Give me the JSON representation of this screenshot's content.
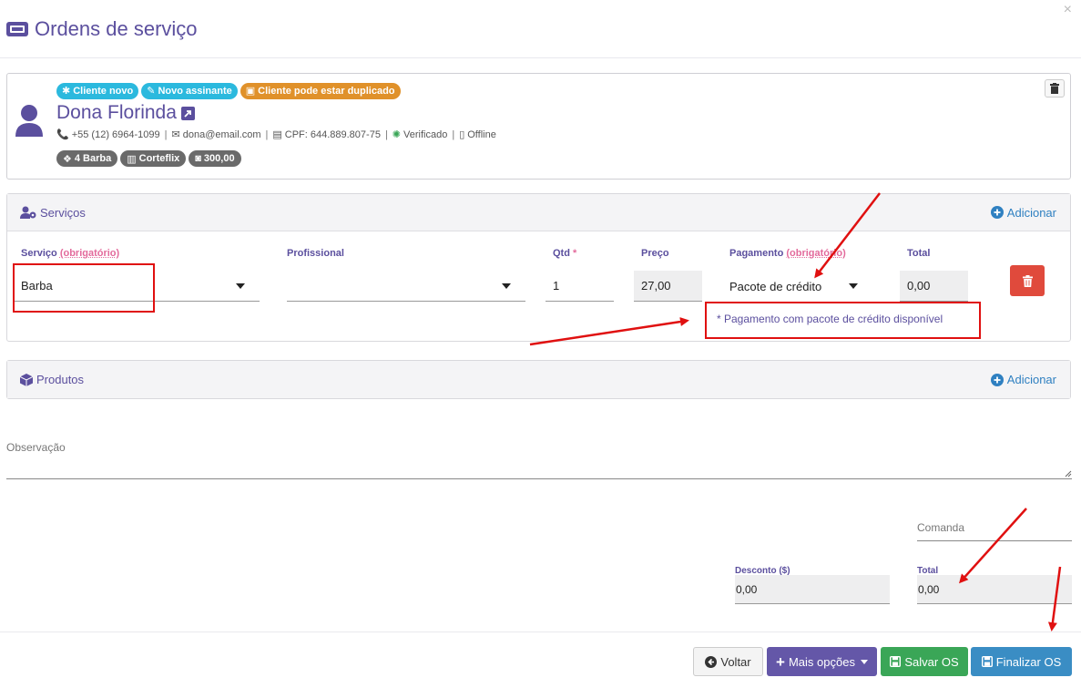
{
  "modal": {
    "title": "Ordens de serviço",
    "close": "×"
  },
  "client": {
    "badges": [
      "Cliente novo",
      "Novo assinante",
      "Cliente pode estar duplicado"
    ],
    "name": "Dona Florinda",
    "phone": "+55 (12) 6964-1099",
    "email": "dona@email.com",
    "cpf": "CPF: 644.889.807-75",
    "verified": "Verificado",
    "status": "Offline",
    "pills": [
      "4 Barba",
      "Corteflix",
      "300,00"
    ]
  },
  "services": {
    "title": "Serviços",
    "add_label": "Adicionar",
    "labels": {
      "service": "Serviço",
      "service_req": "(obrigatório)",
      "professional": "Profissional",
      "qty": "Qtd",
      "qty_star": "*",
      "price": "Preço",
      "payment": "Pagamento",
      "payment_req": "(obrigatório)",
      "total": "Total"
    },
    "row": {
      "service": "Barba",
      "professional": "",
      "qty": "1",
      "price": "27,00",
      "payment": "Pacote de crédito",
      "total": "0,00"
    },
    "hint": "* Pagamento com pacote de crédito disponível"
  },
  "products": {
    "title": "Produtos",
    "add_label": "Adicionar"
  },
  "observation": {
    "label": "Observação",
    "value": ""
  },
  "summary": {
    "comanda_label": "Comanda",
    "discount_label": "Desconto ($)",
    "discount_value": "0,00",
    "total_label": "Total",
    "total_value": "0,00"
  },
  "footer": {
    "back": "Voltar",
    "more": "Mais opções",
    "save": "Salvar OS",
    "finish": "Finalizar OS"
  },
  "colors": {
    "accent": "#5b4f9e",
    "link": "#2f80c1",
    "danger": "#e04a3c",
    "success": "#3aa657",
    "info": "#3a8dc4",
    "annotation": "#e01010"
  }
}
